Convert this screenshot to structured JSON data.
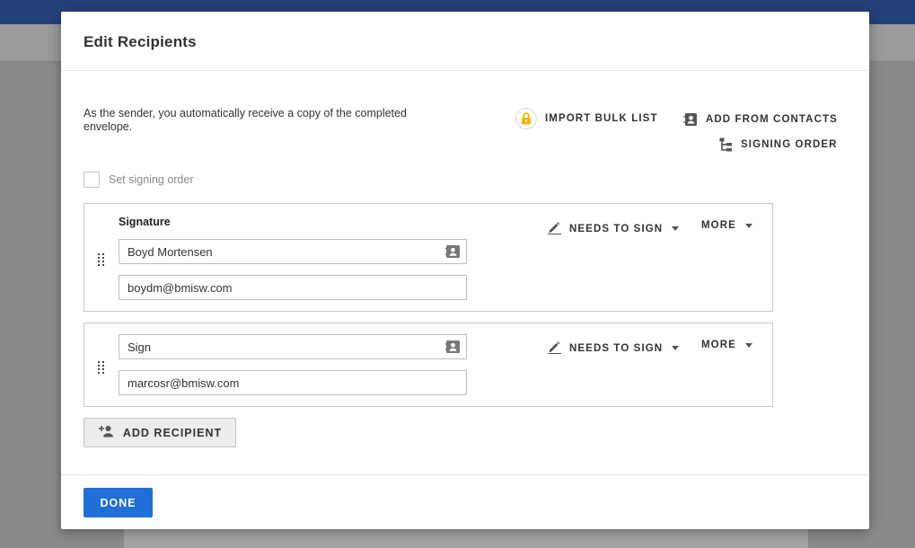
{
  "dialog": {
    "title": "Edit Recipients",
    "sender_note": "As the sender, you automatically receive a copy of the completed envelope."
  },
  "actions": {
    "import_bulk": {
      "label": "IMPORT BULK LIST",
      "icon": "lock-icon"
    },
    "add_contacts": {
      "label": "ADD FROM CONTACTS",
      "icon": "contacts-book-icon"
    },
    "signing_order": {
      "label": "SIGNING ORDER",
      "icon": "hierarchy-icon"
    }
  },
  "signing_order_checkbox": {
    "label": "Set signing order",
    "checked": false
  },
  "recipients": [
    {
      "role_label": "Signature",
      "name": "Boyd Mortensen",
      "email": "boydm@bmisw.com",
      "action": "NEEDS TO SIGN",
      "more": "MORE"
    },
    {
      "role_label": "",
      "name": "Sign",
      "email": "marcosr@bmisw.com",
      "action": "NEEDS TO SIGN",
      "more": "MORE"
    }
  ],
  "add_recipient": {
    "label": "ADD RECIPIENT"
  },
  "footer": {
    "done_label": "DONE"
  },
  "colors": {
    "primary": "#1f6fd6",
    "lock_accent": "#f2b705",
    "backdrop": "#8a8a8a",
    "topbar": "#26407a"
  }
}
